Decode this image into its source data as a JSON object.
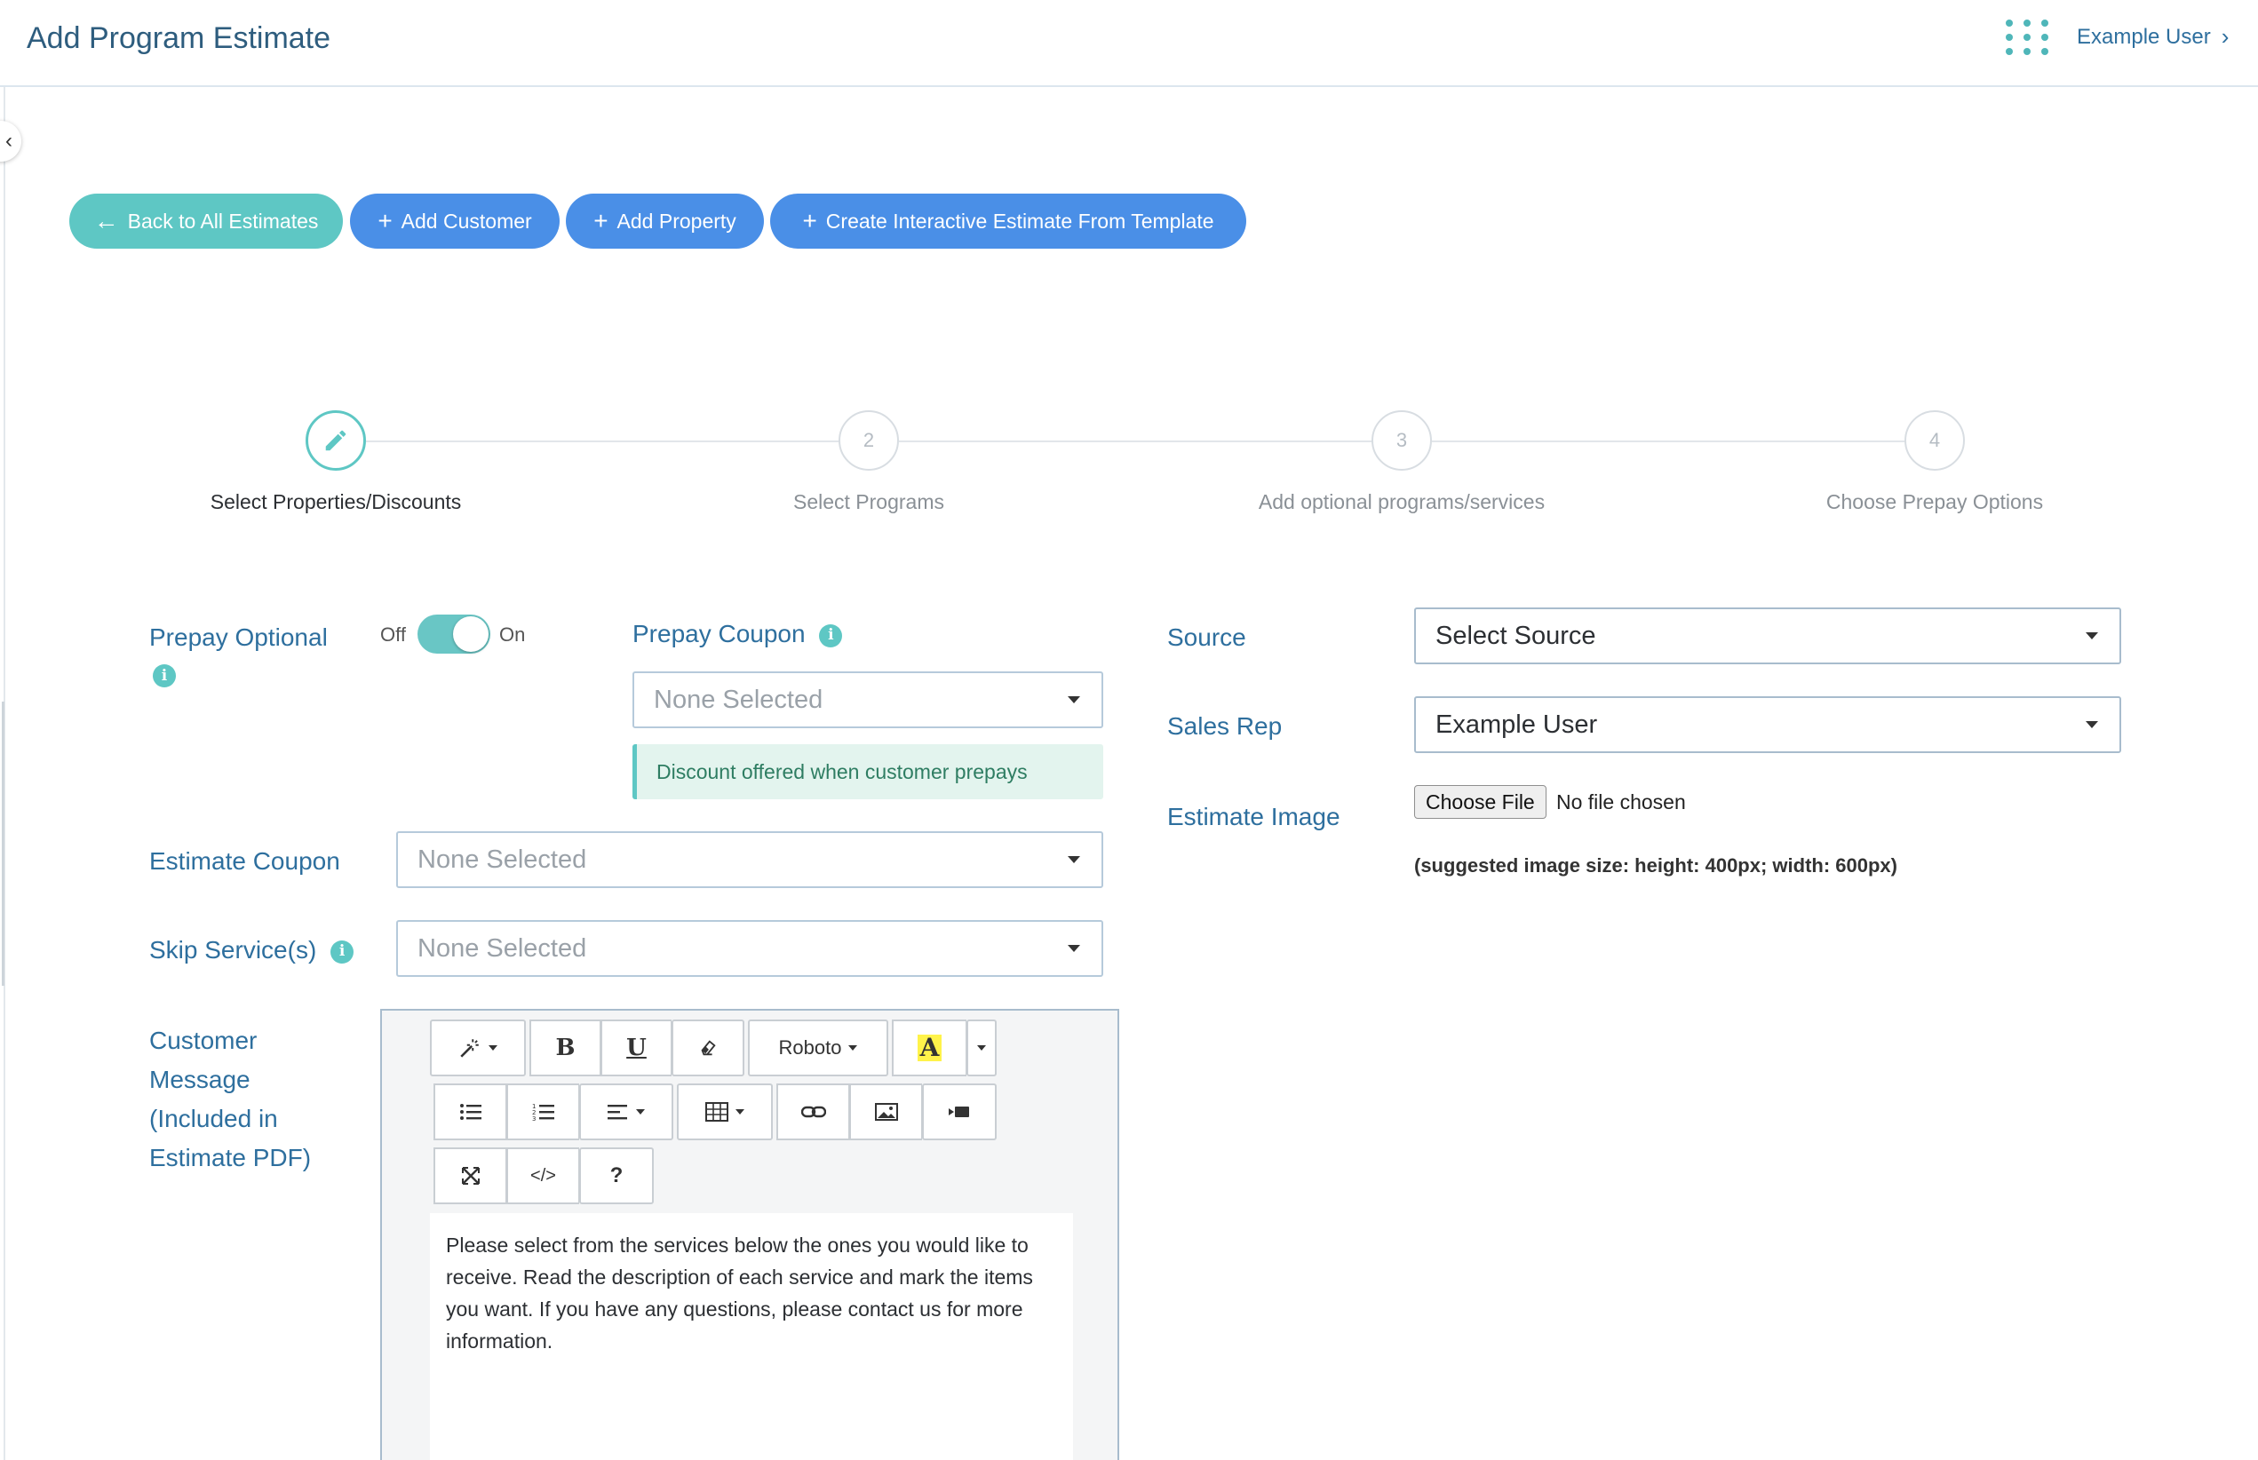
{
  "header": {
    "title": "Add Program Estimate",
    "user_name": "Example User",
    "user_chevron": "›",
    "apps_icon": "grid-dots-icon"
  },
  "sidebar": {
    "collapse_glyph": "‹"
  },
  "actions": {
    "back": "Back to All Estimates",
    "add_customer": "Add Customer",
    "add_property": "Add Property",
    "create_interactive": "Create Interactive Estimate From Template"
  },
  "stepper": {
    "steps": [
      {
        "number": "",
        "label": "Select Properties/Discounts",
        "active": true,
        "icon": "pencil-icon"
      },
      {
        "number": "2",
        "label": "Select Programs"
      },
      {
        "number": "3",
        "label": "Add optional programs/services"
      },
      {
        "number": "4",
        "label": "Choose Prepay Options"
      }
    ]
  },
  "form": {
    "prepay_optional": {
      "label": "Prepay Optional",
      "off_label": "Off",
      "on_label": "On",
      "state": "on"
    },
    "prepay_coupon": {
      "label": "Prepay Coupon",
      "value": "None Selected",
      "hint": "Discount offered when customer prepays"
    },
    "estimate_coupon": {
      "label": "Estimate Coupon",
      "value": "None Selected"
    },
    "skip_services": {
      "label": "Skip Service(s)",
      "value": "None Selected"
    },
    "customer_message": {
      "label_lines": [
        "Customer",
        "Message",
        "(Included in",
        "Estimate PDF)"
      ],
      "font": "Roboto",
      "text": "Please select from the services below the ones you would like to receive. Read the description of each service and mark the items you want. If you have any questions, please contact us for more information."
    },
    "source": {
      "label": "Source",
      "value": "Select Source"
    },
    "sales_rep": {
      "label": "Sales Rep",
      "value": "Example User"
    },
    "estimate_image": {
      "label": "Estimate Image",
      "button": "Choose File",
      "status": "No file chosen",
      "suggestion": "(suggested image size: height: 400px; width: 600px)"
    }
  },
  "editor_toolbar": {
    "bold": "B",
    "underline": "U",
    "code": "</>",
    "help": "?",
    "color_letter": "A"
  },
  "colors": {
    "teal": "#5ec7c4",
    "blue": "#4a8fe7",
    "label": "#2e6f9e"
  }
}
